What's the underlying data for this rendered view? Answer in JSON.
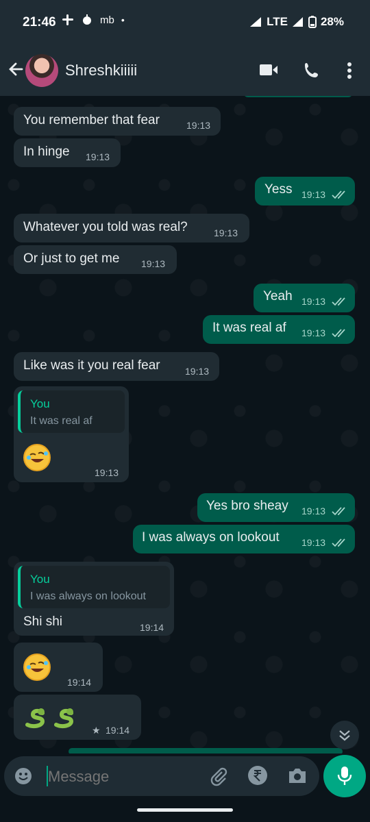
{
  "status_bar": {
    "time": "21:46",
    "carrier_label": "mb",
    "network": "LTE",
    "battery": "28%"
  },
  "header": {
    "contact_name": "Shreshkiiiii"
  },
  "messages": [
    {
      "dir": "in",
      "text": "You remember that fear",
      "time": "19:13"
    },
    {
      "dir": "in",
      "text": "In hinge",
      "time": "19:13"
    },
    {
      "dir": "out",
      "text": "Yess",
      "time": "19:13"
    },
    {
      "dir": "in",
      "text": "Whatever you told was real?",
      "time": "19:13"
    },
    {
      "dir": "in",
      "text": "Or just to get me",
      "time": "19:13"
    },
    {
      "dir": "out",
      "text": "Yeah",
      "time": "19:13"
    },
    {
      "dir": "out",
      "text": "It was real af",
      "time": "19:13"
    },
    {
      "dir": "in",
      "text": "Like was it you real fear",
      "time": "19:13"
    },
    {
      "dir": "in",
      "reply_name": "You",
      "reply_text": "It was real af",
      "emoji": "rolling-on-floor-laughing",
      "time": "19:13"
    },
    {
      "dir": "out",
      "text": "Yes bro sheay",
      "time": "19:13"
    },
    {
      "dir": "out",
      "text": "I was always on lookout",
      "time": "19:13"
    },
    {
      "dir": "in",
      "reply_name": "You",
      "reply_text": "I was always on lookout",
      "text": "Shi shi",
      "time": "19:14"
    },
    {
      "dir": "in",
      "emoji": "rolling-on-floor-laughing",
      "time": "19:14"
    },
    {
      "dir": "in",
      "emoji": "snake-snake",
      "starred": true,
      "time": "19:14"
    }
  ],
  "composer": {
    "placeholder": "Message"
  },
  "colors": {
    "incoming": "#202c33",
    "outgoing": "#005c4b",
    "accent": "#00a884",
    "read_ticks": "#a7d6cb"
  }
}
